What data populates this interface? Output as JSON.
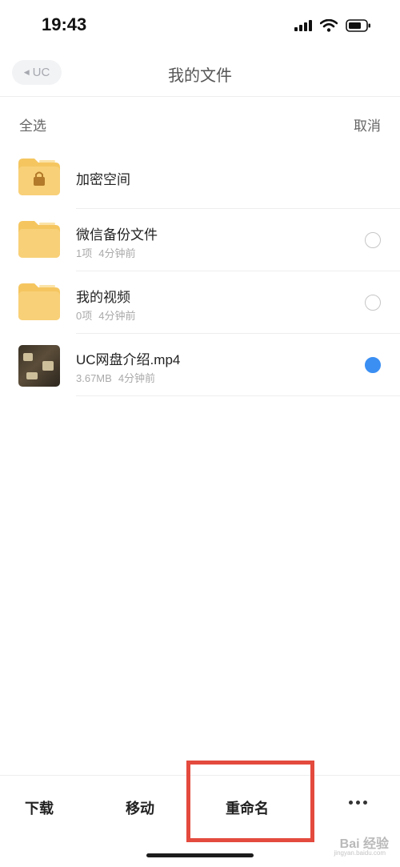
{
  "status_bar": {
    "time": "19:43"
  },
  "nav": {
    "back_label": "UC",
    "title": "我的文件"
  },
  "selection_bar": {
    "select_all": "全选",
    "cancel": "取消"
  },
  "files": [
    {
      "name": "加密空间",
      "count": "",
      "time": "",
      "type": "locked-folder",
      "selected": null
    },
    {
      "name": "微信备份文件",
      "count": "1项",
      "time": "4分钟前",
      "type": "folder",
      "selected": false
    },
    {
      "name": "我的视频",
      "count": "0项",
      "time": "4分钟前",
      "type": "folder",
      "selected": false
    },
    {
      "name": "UC网盘介绍.mp4",
      "count": "3.67MB",
      "time": "4分钟前",
      "type": "video",
      "selected": true
    }
  ],
  "toolbar": {
    "download": "下载",
    "move": "移动",
    "rename": "重命名",
    "more_icon": "more-horizontal-icon"
  },
  "colors": {
    "accent": "#3b8ff3",
    "folder": "#f7cd6c",
    "highlight": "#e44a3e"
  },
  "watermark": {
    "text": "Bai 经验",
    "sub": "jingyan.baidu.com"
  }
}
